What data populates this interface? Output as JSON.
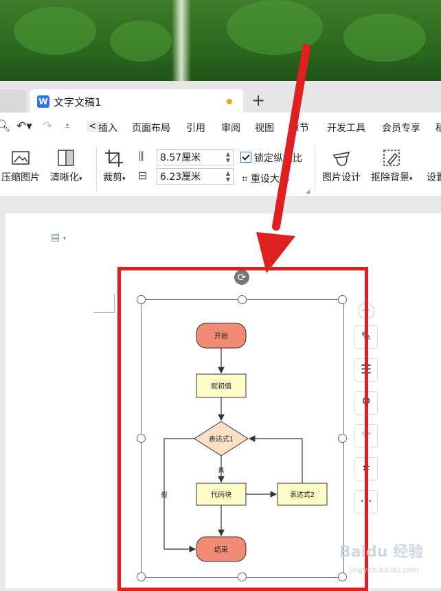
{
  "tab": {
    "title": "文字文稿1",
    "new_tab": "+"
  },
  "menu": {
    "scroll_left": "<",
    "items": [
      "插入",
      "页面布局",
      "引用",
      "审阅",
      "视图",
      "章节",
      "开发工具",
      "会员专享",
      "稻"
    ]
  },
  "ribbon": {
    "compress": "压缩图片",
    "clarity": "清晰化",
    "crop": "裁剪",
    "width_value": "8.57厘米",
    "height_value": "6.23厘米",
    "lock_ratio": "锁定纵横比",
    "reset_size": "重设大小",
    "image_design": "图片设计",
    "remove_bg": "抠除背景",
    "settings": "设置"
  },
  "flowchart": {
    "start": "开始",
    "assign": "赋初值",
    "expr1": "表达式1",
    "true_label": "真",
    "false_label": "假",
    "code_block": "代码块",
    "expr2": "表达式2",
    "end": "结束"
  },
  "side_tools": {
    "more": "···"
  },
  "watermark": {
    "main": "Baidu 经验",
    "sub": "jingyan.baidu.com"
  },
  "colors": {
    "highlight": "#e02020",
    "start_end_fill": "#f28b73",
    "process_fill": "#fdfbc7",
    "decision_fill": "#fde0c3"
  }
}
